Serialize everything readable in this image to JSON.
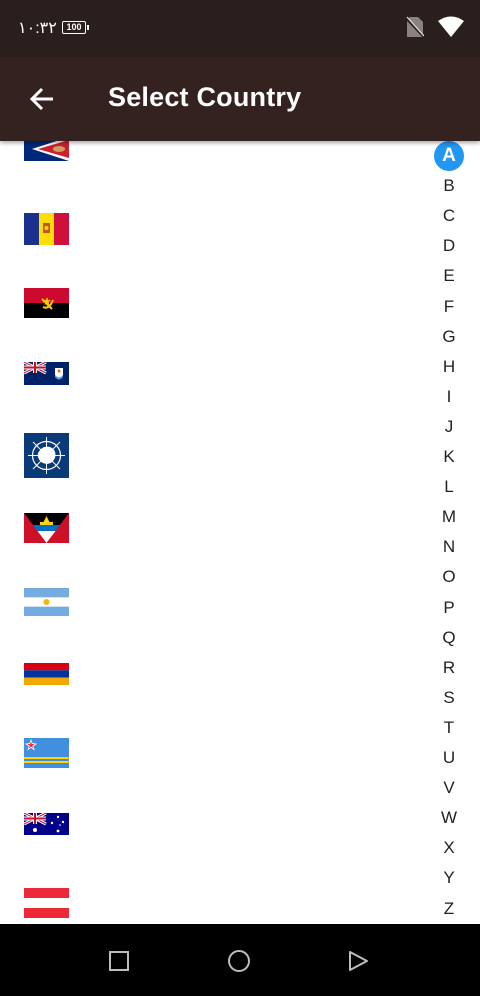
{
  "status_bar": {
    "time": "١٠:٣٢",
    "battery": "100",
    "icons": [
      "no-sim-icon",
      "wifi-icon"
    ]
  },
  "app_bar": {
    "title": "Select Country",
    "back_icon": "arrow-left-icon"
  },
  "countries": [
    {
      "name": "american-samoa",
      "icon": "flag-american-samoa-icon"
    },
    {
      "name": "andorra",
      "icon": "flag-andorra-icon"
    },
    {
      "name": "angola",
      "icon": "flag-angola-icon"
    },
    {
      "name": "anguilla",
      "icon": "flag-anguilla-icon"
    },
    {
      "name": "antarctica",
      "icon": "flag-antarctica-icon"
    },
    {
      "name": "antigua-and-barbuda",
      "icon": "flag-antigua-icon"
    },
    {
      "name": "argentina",
      "icon": "flag-argentina-icon"
    },
    {
      "name": "armenia",
      "icon": "flag-armenia-icon"
    },
    {
      "name": "aruba",
      "icon": "flag-aruba-icon"
    },
    {
      "name": "australia",
      "icon": "flag-australia-icon"
    },
    {
      "name": "austria",
      "icon": "flag-austria-icon"
    }
  ],
  "index": {
    "letters": [
      "A",
      "B",
      "C",
      "D",
      "E",
      "F",
      "G",
      "H",
      "I",
      "J",
      "K",
      "L",
      "M",
      "N",
      "O",
      "P",
      "Q",
      "R",
      "S",
      "T",
      "U",
      "V",
      "W",
      "X",
      "Y",
      "Z"
    ],
    "active": "A",
    "active_color": "#2196f3"
  },
  "nav_bar": {
    "icons": [
      "recents-square-icon",
      "home-circle-icon",
      "back-triangle-icon"
    ]
  },
  "colors": {
    "status_bar": "#2a1f1d",
    "app_bar": "#33221f",
    "accent": "#2196f3"
  }
}
